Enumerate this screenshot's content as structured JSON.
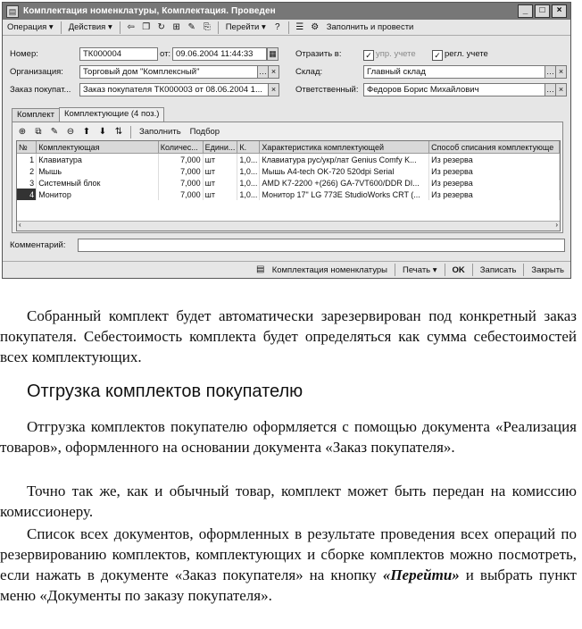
{
  "window": {
    "title": "Комплектация номенклатуры, Комплектация. Проведен",
    "controls": {
      "minimize": "_",
      "maximize": "□",
      "close": "×"
    }
  },
  "toolbar": {
    "operation": "Операция ▾",
    "actions": "Действия ▾",
    "goto": "Перейти ▾",
    "help": "?",
    "fill_and_post": "Заполнить и провести"
  },
  "form": {
    "number_label": "Номер:",
    "number_value": "ТК000004",
    "date_label": "от:",
    "date_value": "09.06.2004 11:44:33",
    "reflect_label": "Отразить в:",
    "upr_label": "упр. учете",
    "regl_label": "регл. учете",
    "org_label": "Организация:",
    "org_value": "Торговый дом \"Комплексный\"",
    "warehouse_label": "Склад:",
    "warehouse_value": "Главный склад",
    "order_label": "Заказ покупат...",
    "order_value": "Заказ покупателя ТК000003 от 08.06.2004 1...",
    "responsible_label": "Ответственный:",
    "responsible_value": "Федоров Борис Михайлович",
    "comment_label": "Комментарий:"
  },
  "tabs": [
    "Комплект",
    "Комплектующие (4 поз.)"
  ],
  "panel": {
    "fill": "Заполнить",
    "select": "Подбор"
  },
  "table": {
    "headers": [
      "№",
      "Комплектующая",
      "Количес...",
      "Едини...",
      "К.",
      "Характеристика комплектующей",
      "Способ списания комплектующе"
    ],
    "rows": [
      [
        "1",
        "Клавиатура",
        "7,000",
        "шт",
        "1,0...",
        "Клавиатура рус/укр/лат Genius Comfy K...",
        "Из резерва"
      ],
      [
        "2",
        "Мышь",
        "7,000",
        "шт",
        "1,0...",
        "Мышь A4-tech OK-720 520dpi Serial",
        "Из резерва"
      ],
      [
        "3",
        "Системный блок",
        "7,000",
        "шт",
        "1,0...",
        "AMD K7-2200 +(266) GA-7VT600/DDR DI...",
        "Из резерва"
      ],
      [
        "4",
        "Монитор",
        "7,000",
        "шт",
        "1,0...",
        "Монитор 17\" LG 773E StudioWorks CRT (...",
        "Из резерва"
      ]
    ]
  },
  "bottom": {
    "kit_report": "Комплектация номенклатуры",
    "print": "Печать ▾",
    "ok": "OK",
    "save": "Записать",
    "close": "Закрыть"
  },
  "text": {
    "p1": "Собранный комплект будет автоматически зарезервирован под конкретный заказ покупателя. Себестоимость комплекта будет определяться как сумма себестоимостей всех комплектующих.",
    "heading": "Отгрузка комплектов покупателю",
    "p2": "Отгрузка комплектов покупателю оформляется с помощью документа «Реализация товаров», оформленного на основании документа «Заказ покупателя».",
    "p3": "Точно так же, как и обычный товар, комплект может быть передан на комиссию комиссионеру.",
    "p4_a": "Список всех документов, оформленных в результате проведения всех операций по резервированию комплектов, комплектующих и сборке комплектов можно посмотреть, если нажать в документе «Заказ покупателя» на кнопку ",
    "p4_b": "«Перейти»",
    "p4_c": " и выбрать пункт меню «Документы по заказу покупателя»."
  }
}
